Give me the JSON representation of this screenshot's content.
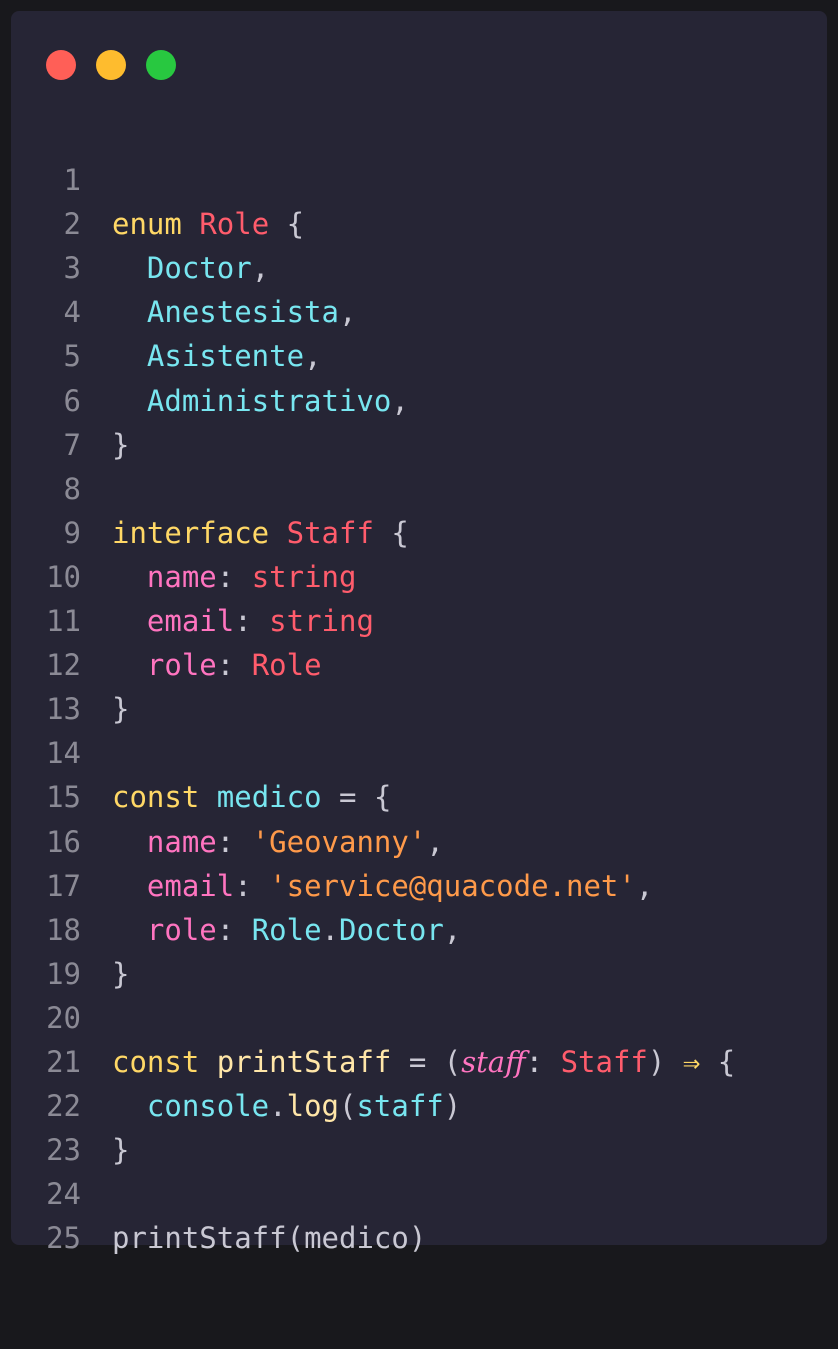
{
  "window": {
    "controls": [
      "close",
      "minimize",
      "maximize"
    ]
  },
  "colors": {
    "background": "#262535",
    "keyword": "#ffd866",
    "type": "#ff5c6c",
    "identifier": "#78e6f0",
    "property": "#ff74c0",
    "string": "#ff9a4a",
    "punctuation": "#c9c8d3",
    "line_number": "#8b8a95"
  },
  "code": {
    "line_numbers": [
      "1",
      "2",
      "3",
      "4",
      "5",
      "6",
      "7",
      "8",
      "9",
      "10",
      "11",
      "12",
      "13",
      "14",
      "15",
      "16",
      "17",
      "18",
      "19",
      "20",
      "21",
      "22",
      "23",
      "24",
      "25"
    ],
    "l1": {
      "kw": "enum",
      "name": "Role",
      "brace": "{"
    },
    "l2": {
      "member": "Doctor",
      "comma": ","
    },
    "l3": {
      "member": "Anestesista",
      "comma": ","
    },
    "l4": {
      "member": "Asistente",
      "comma": ","
    },
    "l5": {
      "member": "Administrativo",
      "comma": ","
    },
    "l6": {
      "brace": "}"
    },
    "l8": {
      "kw": "interface",
      "name": "Staff",
      "brace": "{"
    },
    "l9": {
      "prop": "name",
      "colon": ":",
      "type": "string"
    },
    "l10": {
      "prop": "email",
      "colon": ":",
      "type": "string"
    },
    "l11": {
      "prop": "role",
      "colon": ":",
      "type": "Role"
    },
    "l12": {
      "brace": "}"
    },
    "l14": {
      "kw": "const",
      "name": "medico",
      "eq": "=",
      "brace": "{"
    },
    "l15": {
      "prop": "name",
      "colon": ":",
      "value": "'Geovanny'",
      "comma": ","
    },
    "l16": {
      "prop": "email",
      "colon": ":",
      "value": "'service@quacode.net'",
      "comma": ","
    },
    "l17": {
      "prop": "role",
      "colon": ":",
      "obj": "Role",
      "dot": ".",
      "member": "Doctor",
      "comma": ","
    },
    "l18": {
      "brace": "}"
    },
    "l20": {
      "kw": "const",
      "name": "printStaff",
      "eq": "=",
      "open": "(",
      "param": "staff",
      "colon": ":",
      "type": "Staff",
      "close": ")",
      "arrow": "⇒",
      "brace": "{"
    },
    "l21": {
      "obj": "console",
      "dot": ".",
      "method": "log",
      "open": "(",
      "arg": "staff",
      "close": ")"
    },
    "l22": {
      "brace": "}"
    },
    "l24": {
      "call": "printStaff",
      "open": "(",
      "arg": "medico",
      "close": ")"
    }
  }
}
